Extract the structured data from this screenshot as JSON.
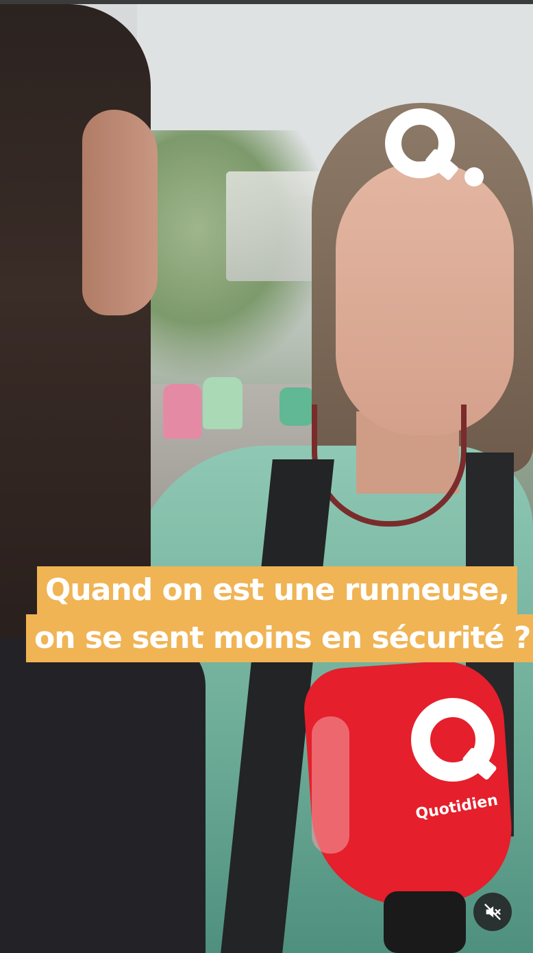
{
  "video": {
    "brand_logo_icon": "quotidien-q-logo-icon",
    "subtitle_lines": [
      "Quand on est une runneuse,",
      "on se sent moins en sécurité ?"
    ],
    "mic_brand_text": "Quotidien",
    "mute_button_icon": "speaker-muted-icon"
  },
  "colors": {
    "subtitle_background": "#f0b455",
    "subtitle_text": "#ffffff",
    "mic_red": "#e51f2b",
    "control_background": "#232326"
  }
}
